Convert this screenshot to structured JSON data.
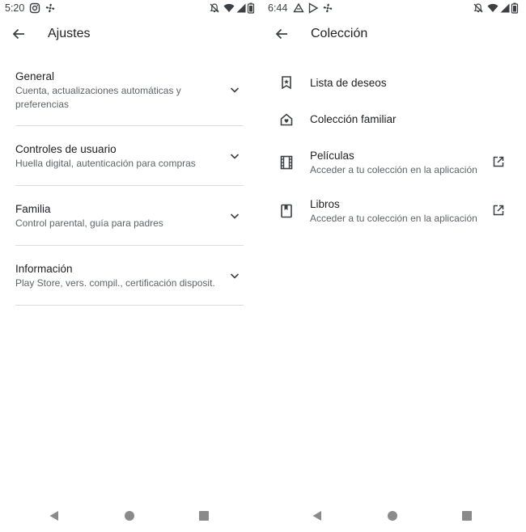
{
  "left": {
    "status": {
      "time": "5:20",
      "icons": [
        "instagram-icon",
        "fan-icon",
        "muted-bell-icon",
        "wifi-icon",
        "signal-icon",
        "battery-icon"
      ]
    },
    "title": "Ajustes",
    "settings": [
      {
        "title": "General",
        "subtitle": "Cuenta, actualizaciones automáticas y preferencias"
      },
      {
        "title": "Controles de usuario",
        "subtitle": "Huella digital, autenticación para compras"
      },
      {
        "title": "Familia",
        "subtitle": "Control parental, guía para padres"
      },
      {
        "title": "Información",
        "subtitle": "Play Store, vers. compil., certificación disposit."
      }
    ]
  },
  "right": {
    "status": {
      "time": "6:44",
      "icons": [
        "drive-icon",
        "play-store-icon",
        "fan-icon",
        "muted-bell-icon",
        "wifi-icon",
        "signal-icon",
        "battery-icon"
      ]
    },
    "title": "Colección",
    "items": [
      {
        "label": "Lista de deseos",
        "icon": "wishlist-bookmark-icon"
      },
      {
        "label": "Colección familiar",
        "icon": "family-home-icon"
      },
      {
        "label": "Películas",
        "subtitle": "Acceder a tu colección en la aplicación",
        "icon": "film-icon",
        "external": true
      },
      {
        "label": "Libros",
        "subtitle": "Acceder a tu colección en la aplicación",
        "icon": "book-icon",
        "external": true
      }
    ]
  },
  "colors": {
    "text": "#202124",
    "secondary": "#5f6368",
    "divider": "#dadce0",
    "icon": "#3c4043"
  }
}
